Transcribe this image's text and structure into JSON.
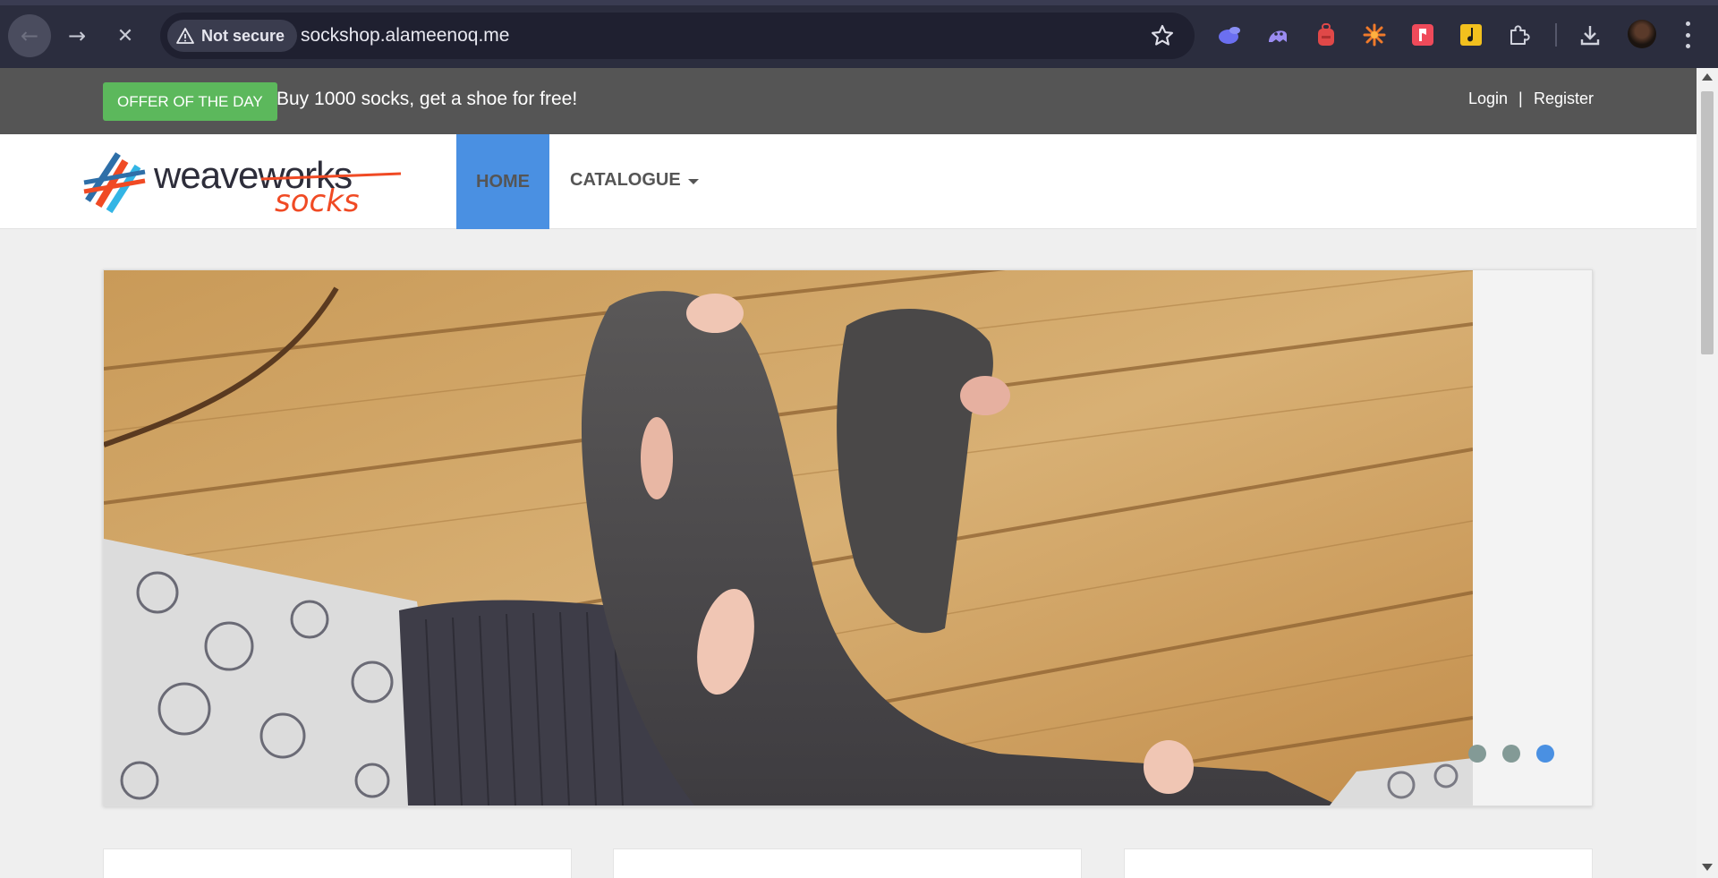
{
  "browser": {
    "security_label": "Not secure",
    "url": "sockshop.alameenoq.me",
    "icons": {
      "back": "arrow-left-icon",
      "forward": "arrow-right-icon",
      "stop": "close-icon",
      "warning": "warning-triangle-icon",
      "bookmark": "star-outline-icon",
      "extensions": [
        "rabbit-extension-icon",
        "ghost-extension-icon",
        "backpack-extension-icon",
        "burst-extension-icon",
        "pocket-extension-icon",
        "music-note-extension-icon",
        "puzzle-extensions-icon"
      ],
      "downloads": "download-icon",
      "profile": "avatar",
      "menu": "kebab-menu-icon"
    }
  },
  "topbar": {
    "offer_badge": "OFFER OF THE DAY",
    "offer_text": "Buy 1000 socks, get a shoe for free!",
    "login": "Login",
    "separator": "|",
    "register": "Register",
    "colors": {
      "bar": "#555555",
      "badge": "#5cb85c"
    }
  },
  "navbar": {
    "logo_primary": "weaveworks",
    "logo_secondary": "socks",
    "items": [
      {
        "label": "HOME",
        "active": true
      },
      {
        "label": "CATALOGUE",
        "has_dropdown": true
      }
    ],
    "colors": {
      "active": "#4a90e2"
    }
  },
  "carousel": {
    "image_subject": "worn grey socks with holes on a wooden deck",
    "slide_count": 3,
    "active_slide": 3
  },
  "cards": {
    "count": 3
  }
}
